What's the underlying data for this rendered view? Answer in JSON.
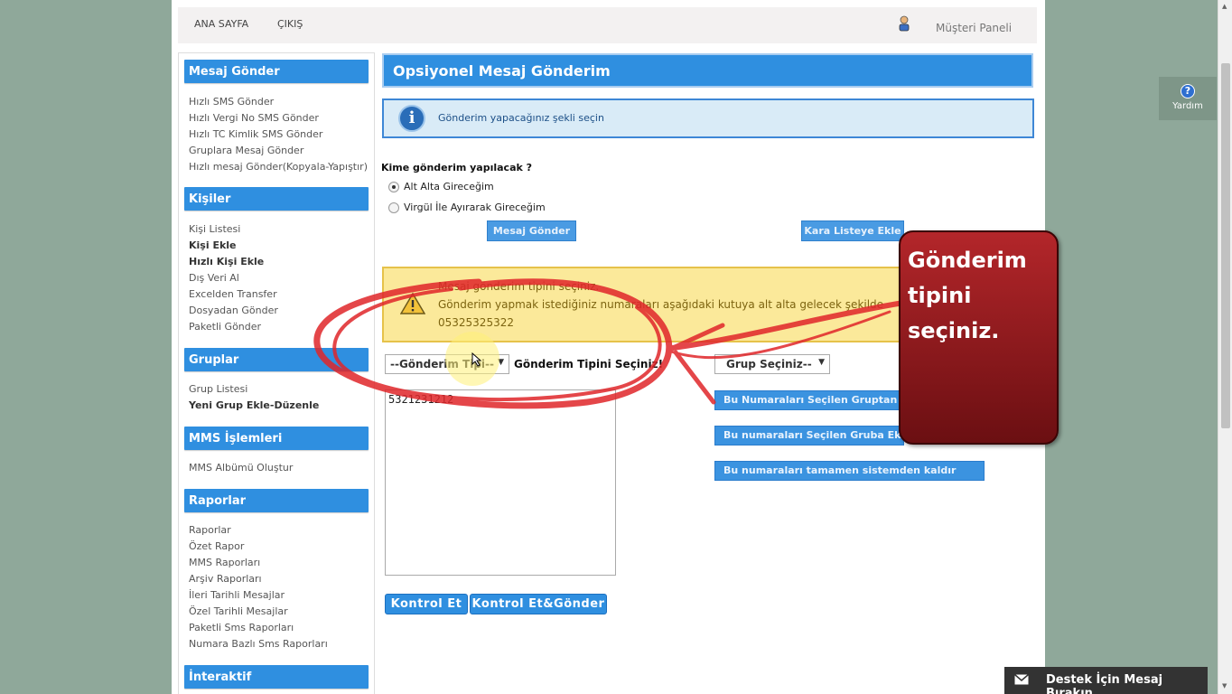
{
  "topbar": {
    "home": "ANA SAYFA",
    "logout": "ÇIKIŞ",
    "panel": "Müşteri Paneli"
  },
  "sidebar": {
    "sections": [
      {
        "title": "Mesaj Gönder",
        "items": [
          {
            "label": "Hızlı SMS Gönder",
            "bold": false
          },
          {
            "label": "Hızlı Vergi No SMS Gönder",
            "bold": false
          },
          {
            "label": "Hızlı TC Kimlik SMS Gönder",
            "bold": false
          },
          {
            "label": "Gruplara Mesaj Gönder",
            "bold": false
          },
          {
            "label": "Hızlı mesaj Gönder(Kopyala-Yapıştır)",
            "bold": false
          }
        ]
      },
      {
        "title": "Kişiler",
        "items": [
          {
            "label": "Kişi Listesi",
            "bold": false
          },
          {
            "label": "Kişi Ekle",
            "bold": true
          },
          {
            "label": "Hızlı Kişi Ekle",
            "bold": true
          },
          {
            "label": "Dış Veri Al",
            "bold": false
          },
          {
            "label": "Excelden Transfer",
            "bold": false
          },
          {
            "label": "Dosyadan Gönder",
            "bold": false
          },
          {
            "label": "Paketli Gönder",
            "bold": false
          }
        ]
      },
      {
        "title": "Gruplar",
        "items": [
          {
            "label": "Grup Listesi",
            "bold": false
          },
          {
            "label": "Yeni Grup Ekle-Düzenle",
            "bold": true
          }
        ]
      },
      {
        "title": "MMS İşlemleri",
        "items": [
          {
            "label": "MMS Albümü Oluştur",
            "bold": false
          }
        ]
      },
      {
        "title": "Raporlar",
        "items": [
          {
            "label": "Raporlar",
            "bold": false
          },
          {
            "label": "Özet Rapor",
            "bold": false
          },
          {
            "label": "MMS Raporları",
            "bold": false
          },
          {
            "label": "Arşiv Raporları",
            "bold": false
          },
          {
            "label": "İleri Tarihli Mesajlar",
            "bold": false
          },
          {
            "label": "Özel Tarihli Mesajlar",
            "bold": false
          },
          {
            "label": "Paketli Sms Raporları",
            "bold": false
          },
          {
            "label": "Numara Bazlı Sms Raporları",
            "bold": false
          }
        ]
      },
      {
        "title": "İnteraktif",
        "items": []
      }
    ]
  },
  "main": {
    "title": "Opsiyonel Mesaj Gönderim",
    "info": "Gönderim yapacağınız şekli seçin",
    "question": "Kime gönderim yapılacak ?",
    "radio_1": "Alt Alta Gireceğim",
    "radio_2": "Virgül İle Ayırarak Gireceğim",
    "btn_send": "Mesaj Gönder",
    "btn_blacklist": "Kara Listeye Ekle",
    "warn_title": "Mesaj gönderim tipini seçiniz.",
    "warn_line": "Gönderim yapmak istediğiniz numaraları aşağıdaki kutuya alt alta gelecek şekilde",
    "warn_example": "05325325322",
    "select_value": "--Gönderim Tipi--",
    "select_label": "Gönderim Tipini Seçiniz!",
    "grup_select": "Grup Seçiniz--",
    "textarea_value": "5321231212",
    "btn_remove_group": "Bu Numaraları Seçilen Gruptan Çıkar",
    "btn_add_group": "Bu numaraları Seçilen Gruba Ekle",
    "btn_remove_all": "Bu numaraları tamamen sistemden kaldır",
    "btn_check": "Kontrol Et",
    "btn_check_send": "Kontrol Et&Gönder"
  },
  "callout": {
    "line1": "Gönderim",
    "line2": "tipini",
    "line3": "seçiniz."
  },
  "help": "Yardım",
  "support": "Destek İçin Mesaj Bırakın",
  "colors": {
    "accent": "#2f8fe0",
    "warning_bg": "#fbe99a",
    "callout_red": "#b3262a",
    "background": "#8fa89a"
  }
}
